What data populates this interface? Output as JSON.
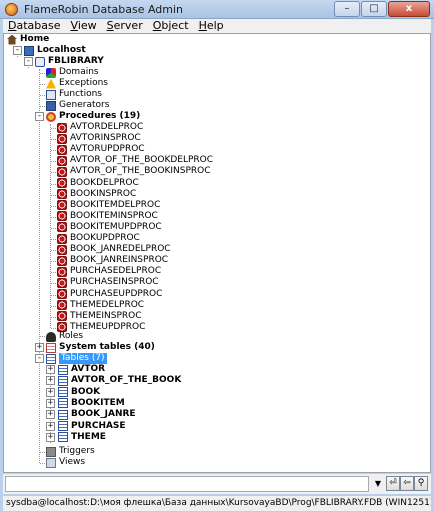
{
  "window": {
    "title": "FlameRobin Database Admin",
    "buttons": {
      "minimize": "–",
      "maximize": "□",
      "close": "x"
    }
  },
  "menu": [
    {
      "label_u": "D",
      "label_rest": "atabase"
    },
    {
      "label_u": "V",
      "label_rest": "iew"
    },
    {
      "label_u": "S",
      "label_rest": "erver"
    },
    {
      "label_u": "O",
      "label_rest": "bject"
    },
    {
      "label_u": "H",
      "label_rest": "elp"
    }
  ],
  "tree": {
    "home": "Home",
    "localhost": "Localhost",
    "database": "FBLIBRARY",
    "domains": "Domains",
    "exceptions": "Exceptions",
    "functions": "Functions",
    "generators": "Generators",
    "procedures": "Procedures (19)",
    "procedure_items": [
      "AVTORDELPROC",
      "AVTORINSPROC",
      "AVTORUPDPROC",
      "AVTOR_OF_THE_BOOKDELPROC",
      "AVTOR_OF_THE_BOOKINSPROC",
      "BOOKDELPROC",
      "BOOKINSPROC",
      "BOOKITEMDELPROC",
      "BOOKITEMINSPROC",
      "BOOKITEMUPDPROC",
      "BOOKUPDPROC",
      "BOOK_JANREDELPROC",
      "BOOK_JANREINSPROC",
      "PURCHASEDELPROC",
      "PURCHASEINSPROC",
      "PURCHASEUPDPROC",
      "THEMEDELPROC",
      "THEMEINSPROC",
      "THEMEUPDPROC"
    ],
    "roles": "Roles",
    "system_tables": "System tables (40)",
    "tables": "Tables (7)",
    "table_items": [
      "AVTOR",
      "AVTOR_OF_THE_BOOK",
      "BOOK",
      "BOOKITEM",
      "BOOK_JANRE",
      "PURCHASE",
      "THEME"
    ],
    "triggers": "Triggers",
    "views": "Views"
  },
  "command": {
    "value": "",
    "nav": [
      "⏎",
      "⇦",
      "⇨",
      "⚲"
    ]
  },
  "status": "sysdba@localhost:D:\\моя флешка\\База данных\\KursovayaBD\\Prog\\FBLIBRARY.FDB (WIN1251)"
}
